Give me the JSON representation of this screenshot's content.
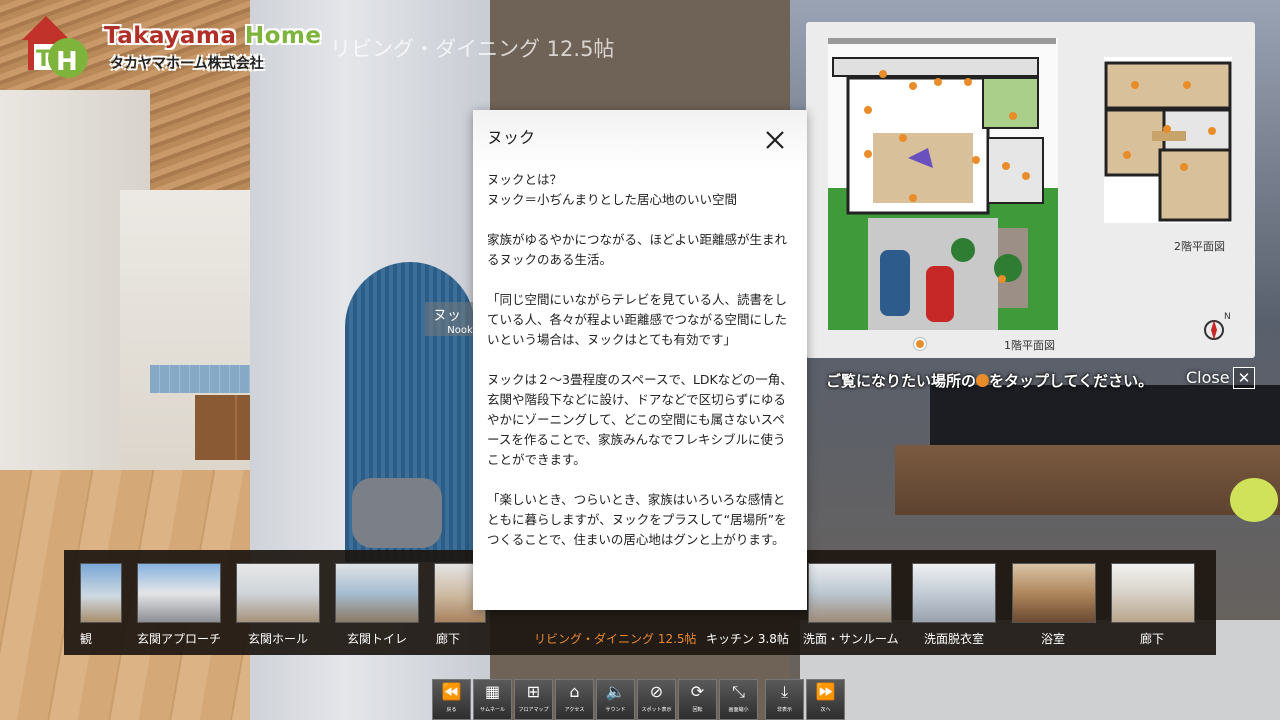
{
  "header": {
    "logo_name_part1": "Takayama ",
    "logo_name_part2": "Home",
    "logo_subtitle": "タカヤマホーム株式会社",
    "scene_title": "リビング・ダイニング 12.5帖"
  },
  "hotspot": {
    "label_jp": "ヌッ",
    "label_en": "Nook"
  },
  "floor_plan": {
    "label_1f": "1階平面図",
    "label_2f": "2階平面図",
    "help_before": "ご覧になりたい場所の",
    "help_after": "をタップしてください。",
    "close_label": "Close",
    "close_x": "✕",
    "colors": {
      "marker": "#e88d2a",
      "garden": "#3f9a3a"
    }
  },
  "modal": {
    "title": "ヌック",
    "paragraphs": [
      "ヌックとは？\nヌック＝小ぢんまりとした居心地のいい空間",
      "家族がゆるやかにつながる、ほどよい距離感が生まれるヌックのある生活。",
      "「同じ空間にいながらテレビを見ている人、読書をしている人、各々が程よい距離感でつながる空間にしたいという場合は、ヌックはとても有効です」",
      "ヌックは２～3畳程度のスペースで、LDKなどの一角、玄関や階段下などに設け、ドアなどで区切らずにゆるやかにゾーニングして、どこの空間にも属さないスペースを作ることで、家族みんなでフレキシブルに使うことができます。",
      "「楽しいとき、つらいとき、家族はいろいろな感情とともに暮らしますが、ヌックをプラスして“居場所”をつくることで、住まいの居心地はグンと上がります。"
    ]
  },
  "thumbnails": [
    {
      "label": "観",
      "active": false
    },
    {
      "label": "玄関アプローチ",
      "active": false
    },
    {
      "label": "玄関ホール",
      "active": false
    },
    {
      "label": "玄関トイレ",
      "active": false
    },
    {
      "label": "廊下",
      "active": false
    },
    {
      "label": "リビング・ダイニング 12.5帖",
      "active": true
    },
    {
      "label": "キッチン 3.8帖",
      "active": false
    },
    {
      "label": "洗面・サンルーム",
      "active": false
    },
    {
      "label": "洗面脱衣室",
      "active": false
    },
    {
      "label": "浴室",
      "active": false
    },
    {
      "label": "廊下",
      "active": false
    }
  ],
  "toolbar": [
    {
      "icon": "rewind-icon",
      "glyph": "⏪",
      "label": "戻る"
    },
    {
      "icon": "grid-icon",
      "glyph": "▦",
      "label": "サムネール"
    },
    {
      "icon": "floorplan-icon",
      "glyph": "⊞",
      "label": "フロアマップ"
    },
    {
      "icon": "access-icon",
      "glyph": "⌂",
      "label": "アクセス"
    },
    {
      "icon": "sound-icon",
      "glyph": "🔈",
      "label": "サウンド"
    },
    {
      "icon": "no-sphere-icon",
      "glyph": "⊘",
      "label": "スポット表示"
    },
    {
      "icon": "rotate-icon",
      "glyph": "⟳",
      "label": "回転"
    },
    {
      "icon": "shrink-icon",
      "glyph": "⤡",
      "label": "画面縮小"
    },
    {
      "icon": "download-icon",
      "glyph": "⤓",
      "label": "非表示"
    },
    {
      "icon": "forward-icon",
      "glyph": "⏩",
      "label": "次へ"
    }
  ]
}
